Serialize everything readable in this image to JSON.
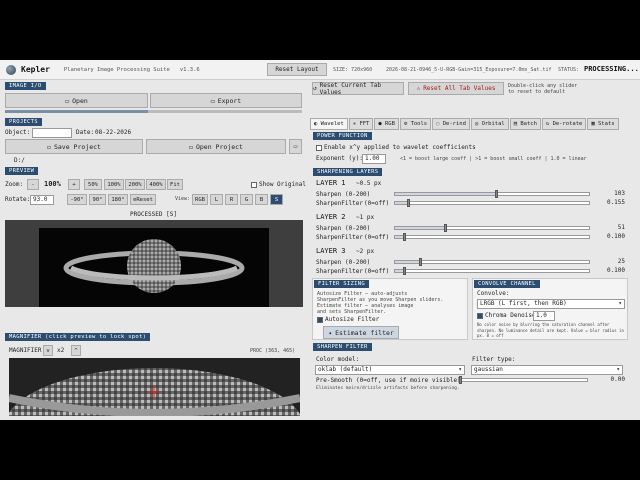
{
  "titlebar": {
    "app_name": "Kepler",
    "subtitle": "Planetary Image Processing Suite",
    "version": "v1.3.6",
    "reset_layout": "Reset Layout",
    "size": "SIZE: 720x960",
    "filename": "2026-08-21-0946_5-U-RGB-Gain=315_Exposure=7.0ms_Sat.tif",
    "status_label": "STATUS:",
    "status_value": "PROCESSING..."
  },
  "image_io": {
    "header": "IMAGE I/O",
    "open": "Open",
    "export": "Export"
  },
  "projects": {
    "header": "PROJECTS",
    "object_label": "Object:",
    "object_value": "",
    "date_label": "Date:",
    "date_value": "08-22-2026",
    "save": "Save Project",
    "open": "Open Project",
    "path": "D:/"
  },
  "preview": {
    "header": "PREVIEW",
    "zoom_label": "Zoom:",
    "zoom_value": "100%",
    "zoom_minus": "-",
    "zoom_plus": "+",
    "zoom_opts": [
      "50%",
      "100%",
      "200%",
      "400%",
      "Fit"
    ],
    "show_original": "Show Original",
    "rotate_label": "Rotate:",
    "rotate_value": "93.0",
    "rotate_opts": [
      "-90°",
      "90°",
      "180°"
    ],
    "reset": "Reset",
    "view_label": "View:",
    "view_opts": [
      "RGB",
      "L",
      "R",
      "G",
      "B",
      "S"
    ],
    "caption": "PROCESSED [S]"
  },
  "magnifier": {
    "header": "MAGNIFIER (click preview to lock spot)",
    "label": "MAGNIFIER",
    "zoom": "x2",
    "proc": "PROC (363, 465)"
  },
  "right": {
    "reset_current": "Reset Current Tab Values",
    "reset_all": "Reset All Tab Values",
    "hint": "Double-click any slider to reset to default",
    "tabs": [
      "Wavelet",
      "FFT",
      "RGB",
      "Tools",
      "De-rind",
      "Orbital",
      "Batch",
      "De-rotate",
      "Stats"
    ],
    "power": {
      "header": "POWER FUNCTION",
      "enable": "Enable x^y applied to wavelet coefficients",
      "exp_label": "Exponent (y):",
      "exp_value": "1.00",
      "hint": "<1 = boost large coeff  |  >1 = boost small coeff  |  1.0 = linear"
    },
    "layers_header": "SHARPENING LAYERS",
    "layers": [
      {
        "title": "LAYER 1",
        "sub": "~0.5 px",
        "sharpen_label": "Sharpen",
        "sharpen_range": "(0-200)",
        "sharpen_value": "103",
        "filter_label": "SharpenFilter",
        "filter_range": "(0=off)",
        "filter_value": "0.155"
      },
      {
        "title": "LAYER 2",
        "sub": "~1 px",
        "sharpen_label": "Sharpen",
        "sharpen_range": "(0-200)",
        "sharpen_value": "51",
        "filter_label": "SharpenFilter",
        "filter_range": "(0=off)",
        "filter_value": "0.100"
      },
      {
        "title": "LAYER 3",
        "sub": "~2 px",
        "sharpen_label": "Sharpen",
        "sharpen_range": "(0-200)",
        "sharpen_value": "25",
        "filter_label": "SharpenFilter",
        "filter_range": "(0=off)",
        "filter_value": "0.100"
      }
    ],
    "filter_sizing": {
      "header": "FILTER SIZING",
      "desc1": "Autosize Filter — auto-adjusts",
      "desc2": "SharpenFilter as you move Sharpen sliders.",
      "desc3": "Estimate filter — analyses image",
      "desc4": "and sets SharpenFilter.",
      "autosize": "Autosize Filter",
      "estimate": "Estimate filter"
    },
    "convolve": {
      "header": "CONVOLVE CHANNEL",
      "label": "Convolve:",
      "value": "LRGB (L first, then RGB)",
      "chroma_label": "Chroma Denoise",
      "chroma_value": "1.0",
      "desc": "No color noise by blurring the saturation channel after sharpen. No luminance detail are kept. Value = blur radius in px. 0 = off"
    },
    "sharpen_filter": {
      "header": "SHARPEN FILTER",
      "color_label": "Color model:",
      "color_value": "oklab (default)",
      "type_label": "Filter type:",
      "type_value": "gaussian",
      "presmooth_label": "Pre-Smooth",
      "presmooth_range": "(0=off, use if moire visible)",
      "presmooth_value": "0.00",
      "presmooth_hint": "Eliminates moire/drizzle artifacts before sharpening."
    }
  }
}
